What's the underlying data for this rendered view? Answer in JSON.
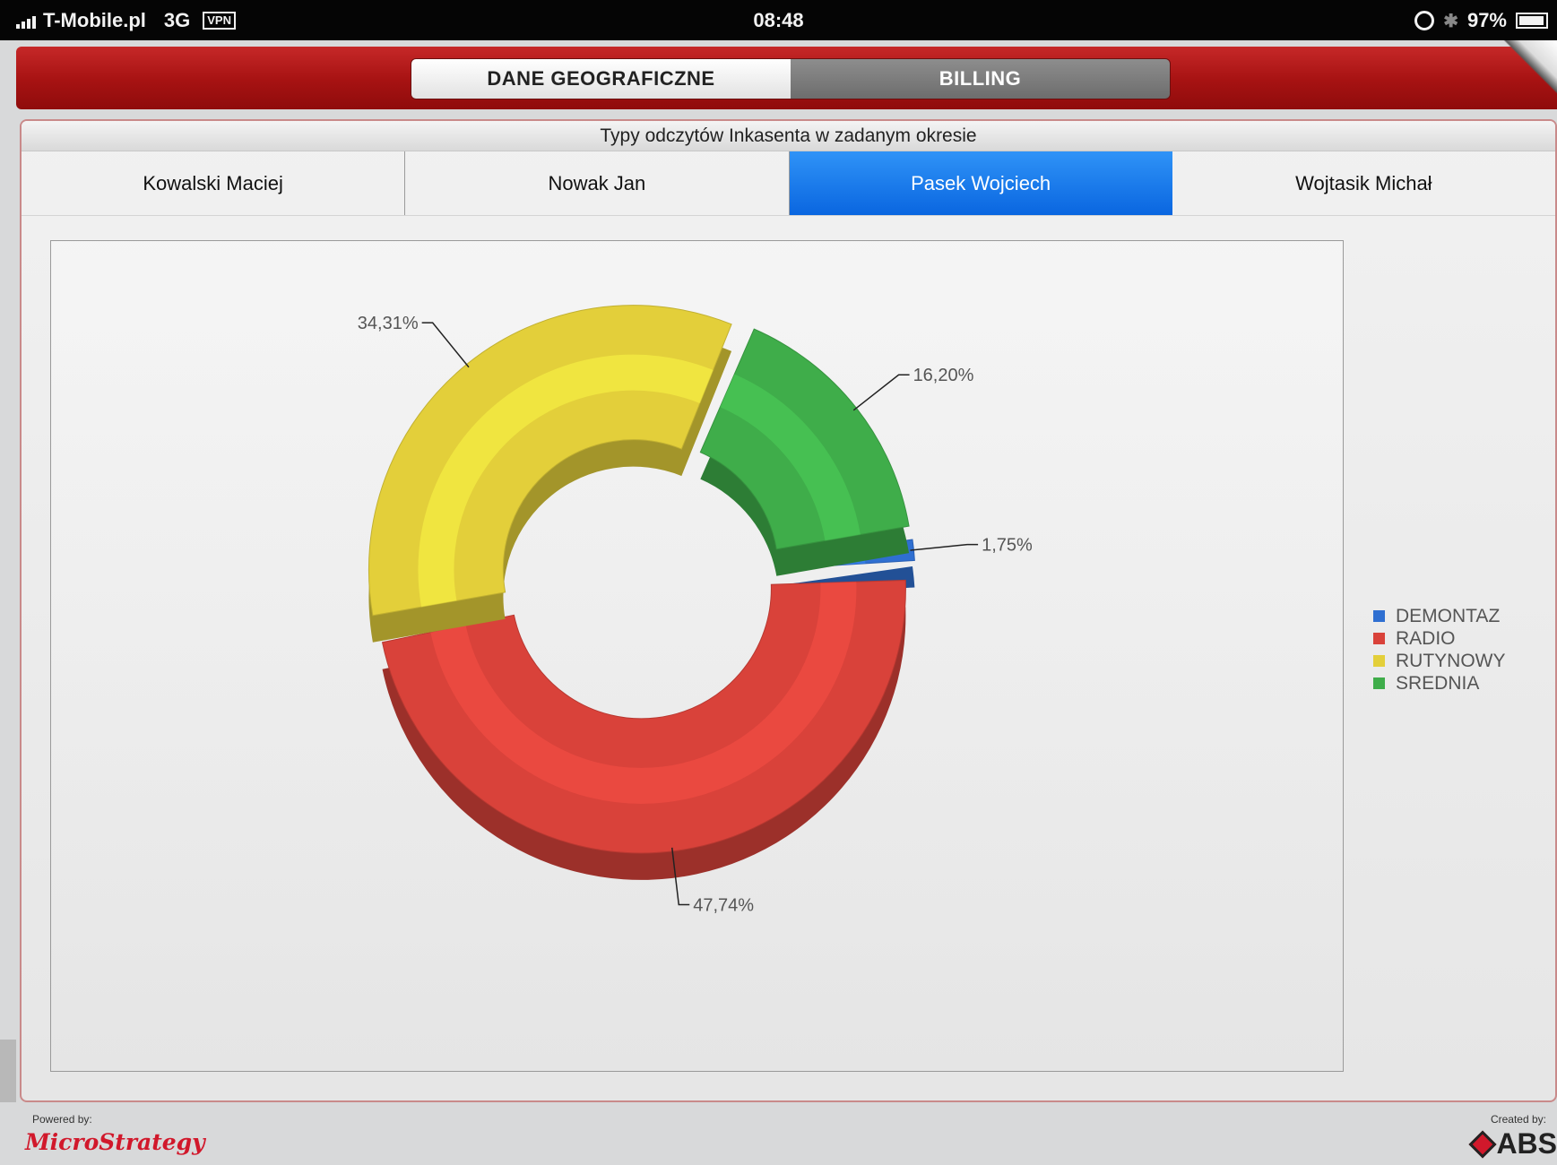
{
  "status_bar": {
    "carrier": "T-Mobile.pl",
    "network": "3G",
    "vpn": "VPN",
    "time": "08:48",
    "battery": "97%",
    "icons": [
      "signal-icon",
      "rotation-lock-icon",
      "bluetooth-icon",
      "battery-icon"
    ]
  },
  "header": {
    "tabs": [
      {
        "label": "DANE GEOGRAFICZNE",
        "active": true
      },
      {
        "label": "BILLING",
        "active": false
      }
    ]
  },
  "panel": {
    "title": "Typy odczytów Inkasenta w zadanym okresie",
    "people": [
      {
        "label": "Kowalski Maciej",
        "selected": false
      },
      {
        "label": "Nowak Jan",
        "selected": false
      },
      {
        "label": "Pasek Wojciech",
        "selected": true
      },
      {
        "label": "Wojtasik Michał",
        "selected": false
      }
    ]
  },
  "chart_data": {
    "type": "pie",
    "variant": "3d-donut",
    "slices": [
      {
        "name": "DEMONTAZ",
        "value": 1.75,
        "label": "1,75%",
        "color": "#2f6fd1"
      },
      {
        "name": "RADIO",
        "value": 47.74,
        "label": "47,74%",
        "color": "#d9423a"
      },
      {
        "name": "RUTYNOWY",
        "value": 34.31,
        "label": "34,31%",
        "color": "#e3cf3a"
      },
      {
        "name": "SREDNIA",
        "value": 16.2,
        "label": "16,20%",
        "color": "#3fad4a"
      }
    ],
    "legend": {
      "placement": "right",
      "entries": [
        "DEMONTAZ",
        "RADIO",
        "RUTYNOWY",
        "SREDNIA"
      ]
    }
  },
  "footer": {
    "powered_by": "Powered by:",
    "microstrategy": "MicroStrategy",
    "created_by": "Created by:",
    "abs": "ABS"
  }
}
